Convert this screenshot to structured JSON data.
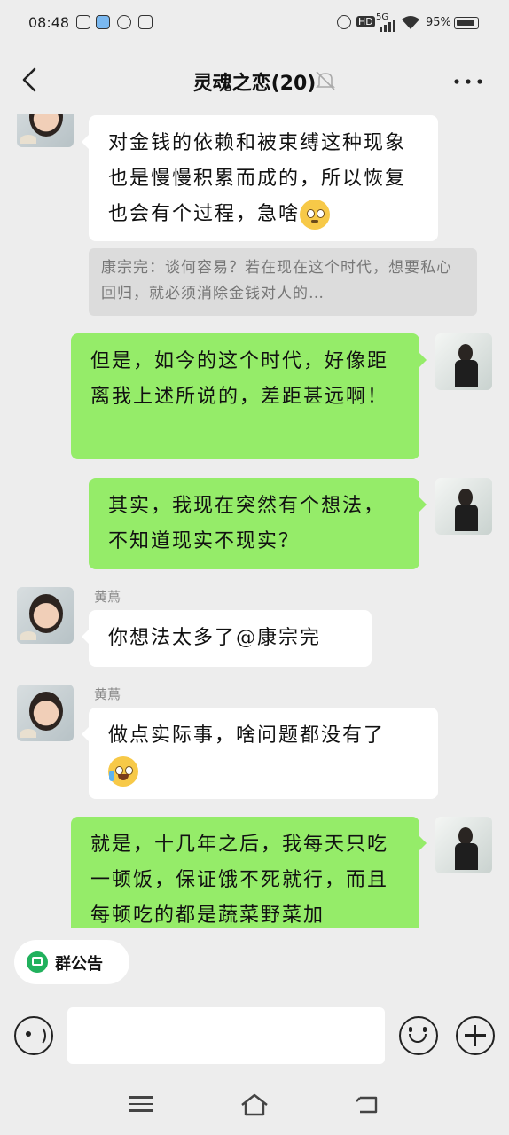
{
  "status_bar": {
    "time": "08:48",
    "hd": "HD",
    "network": "5G",
    "battery": "95%",
    "left_icons": [
      "app-icon",
      "game-icon",
      "link-icon",
      "media-icon"
    ],
    "right_icons": [
      "alarm-icon",
      "hd-icon",
      "signal-icon",
      "wifi-icon",
      "battery-icon"
    ]
  },
  "header": {
    "title": "灵魂之恋(20)",
    "back_icon": "chevron-left-icon",
    "mute_icon": "bell-off-icon",
    "more_icon": "more-icon"
  },
  "messages": [
    {
      "side": "left",
      "sender": "",
      "text": "对金钱的依赖和被束缚这种现象也是慢慢积累而成的，所以恢复也会有个过程，急啥",
      "emoji": "pleading-face"
    },
    {
      "type": "quote",
      "text": "康宗完：谈何容易？若在现在这个时代，想要私心回归，就必须消除金钱对人的…"
    },
    {
      "side": "right",
      "text": "但是，如今的这个时代，好像距离我上述所说的，差距甚远啊！"
    },
    {
      "side": "right",
      "text": "其实，我现在突然有个想法，不知道现实不现实？"
    },
    {
      "side": "left",
      "sender": "黄蔦",
      "text": "你想法太多了@康宗完"
    },
    {
      "side": "left",
      "sender": "黄蔦",
      "text": "做点实际事，啥问题都没有了",
      "emoji": "crying-laughing"
    },
    {
      "side": "right",
      "text": "就是，十几年之后，我每天只吃一顿饭，保证饿不死就行，而且每顿吃的都是蔬菜野菜加"
    }
  ],
  "footer": {
    "notice_label": "群公告",
    "input_placeholder": "",
    "voice_icon": "voice-icon",
    "emoji_icon": "emoji-icon",
    "plus_icon": "plus-icon"
  },
  "colors": {
    "background": "#ededed",
    "sent_bubble": "#95ec69",
    "received_bubble": "#ffffff",
    "notice_green": "#21b15d"
  }
}
